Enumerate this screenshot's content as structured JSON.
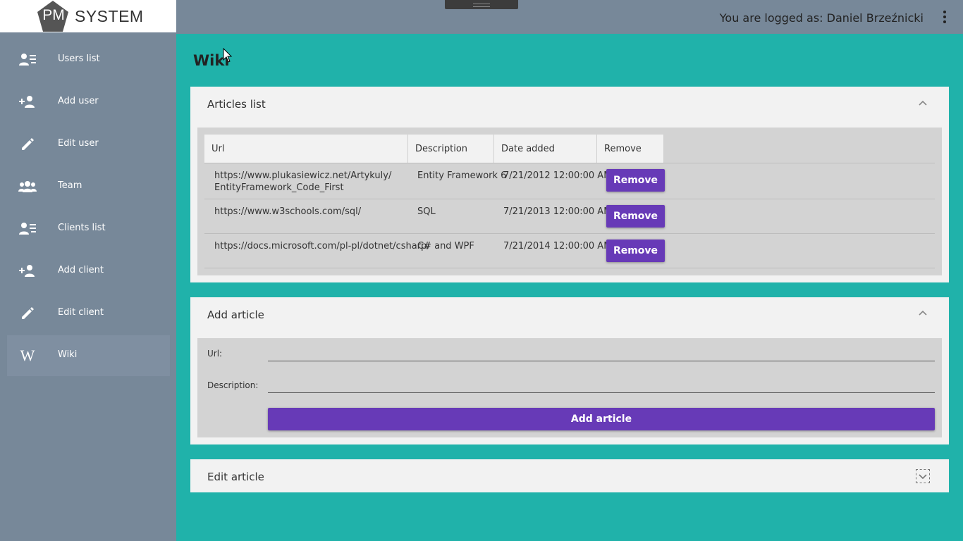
{
  "logo": {
    "badge": "PM",
    "name": "SYSTEM"
  },
  "sidebar": {
    "items": [
      {
        "label": "Users list",
        "icon": "users-list-icon"
      },
      {
        "label": "Add user",
        "icon": "add-user-icon"
      },
      {
        "label": "Edit user",
        "icon": "pencil-icon"
      },
      {
        "label": "Team",
        "icon": "team-icon"
      },
      {
        "label": "Clients list",
        "icon": "clients-list-icon"
      },
      {
        "label": "Add client",
        "icon": "add-client-icon"
      },
      {
        "label": "Edit client",
        "icon": "pencil-icon"
      },
      {
        "label": "Wiki",
        "icon": "wiki-icon",
        "glyph": "W",
        "active": true
      }
    ]
  },
  "header": {
    "logged_as": "You are logged as: Daniel Brzeźnicki"
  },
  "page": {
    "title": "Wiki"
  },
  "articles": {
    "title": "Articles list",
    "columns": [
      "Url",
      "Description",
      "Date added",
      "Remove"
    ],
    "rows": [
      {
        "url_line1": "https://www.plukasiewicz.net/Artykuly/",
        "url_line2": "EntityFramework_Code_First",
        "description": "Entity Framework 6",
        "date": "7/21/2012 12:00:00 AM",
        "action": "Remove"
      },
      {
        "url_line1": "https://www.w3schools.com/sql/",
        "url_line2": "",
        "description": "SQL",
        "date": "7/21/2013 12:00:00 AM",
        "action": "Remove"
      },
      {
        "url_line1": "https://docs.microsoft.com/pl-pl/dotnet/csharp/",
        "url_line2": "",
        "description": "C# and WPF",
        "date": "7/21/2014 12:00:00 AM",
        "action": "Remove"
      }
    ]
  },
  "add_article": {
    "title": "Add article",
    "url_label": "Url:",
    "url_value": "",
    "description_label": "Description:",
    "description_value": "",
    "button": "Add article"
  },
  "edit_article": {
    "title": "Edit article"
  },
  "colors": {
    "accent": "#673ab7",
    "background": "#20b2aa",
    "sidebar": "#778899"
  }
}
